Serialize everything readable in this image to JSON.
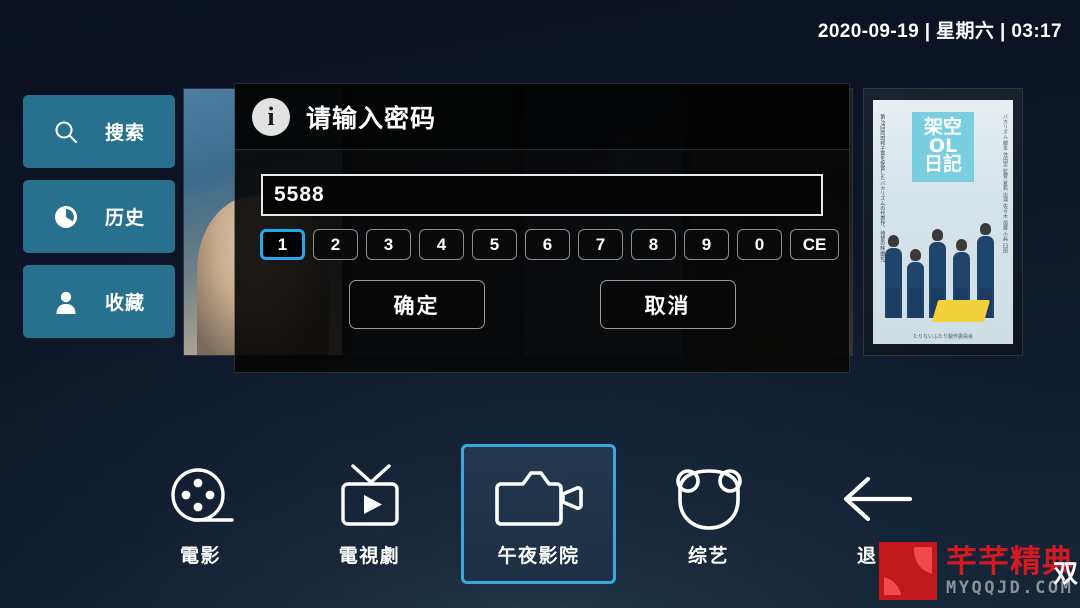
{
  "clock": {
    "text": "2020-09-19 | 星期六 | 03:17"
  },
  "colors": {
    "accent_blue": "#22a8ec",
    "sidebar_blue": "#27718f",
    "selected_border": "#3aa8e0",
    "watermark_red": "#c1181c",
    "background_navy": "#0b1120"
  },
  "sidebar": {
    "items": [
      {
        "label": "搜索",
        "icon": "search-icon"
      },
      {
        "label": "历史",
        "icon": "clock-icon"
      },
      {
        "label": "收藏",
        "icon": "user-icon"
      }
    ]
  },
  "poster_strip": {
    "featured_poster": {
      "title_lines": [
        "架空",
        "OL",
        "日記"
      ],
      "side_text_left": "第39回向田邦子賞を受賞したバカリズムの代表作、待望の映画化!",
      "side_text_right": "バカリズム 脚本 住田崇 監督 夏帆 出演 佐々木 加藤 小峠 臼田",
      "bottom_text": "たりないふたり製作委員会"
    }
  },
  "dialog": {
    "title": "请输入密码",
    "icon": "info-icon",
    "input": {
      "value": "5588",
      "placeholder": ""
    },
    "keypad": [
      "1",
      "2",
      "3",
      "4",
      "5",
      "6",
      "7",
      "8",
      "9",
      "0",
      "CE"
    ],
    "keypad_selected": "1",
    "confirm_label": "确定",
    "cancel_label": "取消"
  },
  "nav": {
    "items": [
      {
        "label": "電影",
        "icon": "film-reel-icon",
        "selected": false
      },
      {
        "label": "電視劇",
        "icon": "television-icon",
        "selected": false
      },
      {
        "label": "午夜影院",
        "icon": "video-camera-icon",
        "selected": true
      },
      {
        "label": "综艺",
        "icon": "bear-head-icon",
        "selected": false
      },
      {
        "label": "退出",
        "icon": "back-arrow-icon",
        "selected": false
      }
    ]
  },
  "watermark": {
    "cn": "芊芊精典",
    "en": "MYQQJD.COM"
  },
  "edge_character": {
    "text": "双"
  }
}
